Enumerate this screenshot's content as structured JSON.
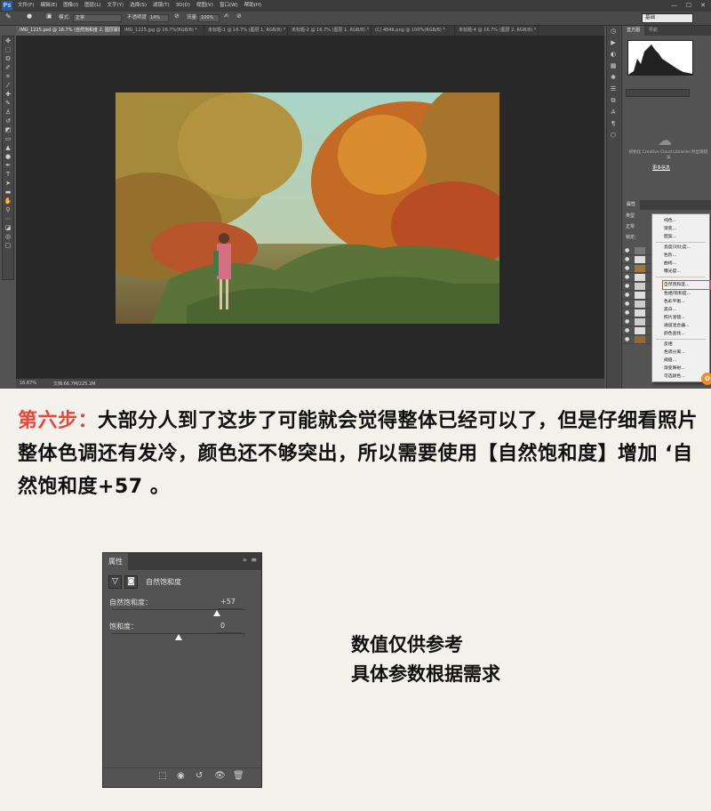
{
  "app": {
    "logo": "Ps",
    "menus": [
      "文件(F)",
      "编辑(E)",
      "图像(I)",
      "图层(L)",
      "文字(Y)",
      "选择(S)",
      "滤镜(T)",
      "3D(D)",
      "视图(V)",
      "窗口(W)",
      "帮助(H)"
    ],
    "window_controls": [
      "—",
      "☐",
      "✕"
    ]
  },
  "options_bar": {
    "mode_label": "模式:",
    "mode_value": "正常",
    "opacity_label": "不透明度:",
    "opacity_value": "14%",
    "flow_label": "流量:",
    "flow_value": "100%",
    "workspace": "基础"
  },
  "tabs": [
    "IMG_1225.psd @ 16.7% (自然饱和度 2, 图层蒙版/8) *",
    "IMG_1225.jpg @ 16.7%(RGB/8) *",
    "未标题-1 @ 16.7% (图层 1, RGB/8) *",
    "未标题-2 @ 16.7% (图层 1, RGB/8) *",
    "(C) 4846.png @ 100%(RGB/8) *",
    "未标题-4 @ 16.7% (图层 2, RGB/8) *"
  ],
  "status": {
    "zoom": "16.67%",
    "doc": "文档:66.7M/225.2M"
  },
  "right_panel": {
    "tab_histogram": "直方图",
    "tab_navigator": "导航",
    "tab_properties": "属性",
    "cc_message": "初始化 Creative Cloud Libraries 时出现错误",
    "cc_link": "更多信息",
    "layers_kind": "类型",
    "blend_mode": "正常",
    "lock_label": "锁定:"
  },
  "context_menu": {
    "items": [
      "纯色...",
      "渐变...",
      "图案...",
      "亮度/对比度...",
      "色阶...",
      "曲线...",
      "曝光度...",
      "自然饱和度...",
      "色相/饱和度...",
      "色彩平衡...",
      "黑白...",
      "照片滤镜...",
      "通道混合器...",
      "颜色查找...",
      "反相",
      "色调分离...",
      "阈值...",
      "渐变映射...",
      "可选颜色..."
    ],
    "highlighted": "自然饱和度..."
  },
  "article": {
    "step_label": "第六步：",
    "step_text": "大部分人到了这步了可能就会觉得整体已经可以了，但是仔细看照片整体色调还有发冷，颜色还不够突出，所以需要使用【自然饱和度】增加 ‘自然饱和度+57 。",
    "note_line1": "数值仅供参考",
    "note_line2": "具体参数根据需求"
  },
  "properties_panel": {
    "title": "属性",
    "menu_icon": "»  ≡",
    "adjustment_name": "自然饱和度",
    "vibrance_label": "自然饱和度：",
    "vibrance_value": "+57",
    "vibrance_level": 57,
    "saturation_label": "饱和度：",
    "saturation_value": "0",
    "saturation_level": 0,
    "slider_range": [
      -100,
      100
    ]
  },
  "colors": {
    "accent_red": "#e9473b",
    "panel_bg": "#535353",
    "page_bg": "#f3f1ec"
  }
}
